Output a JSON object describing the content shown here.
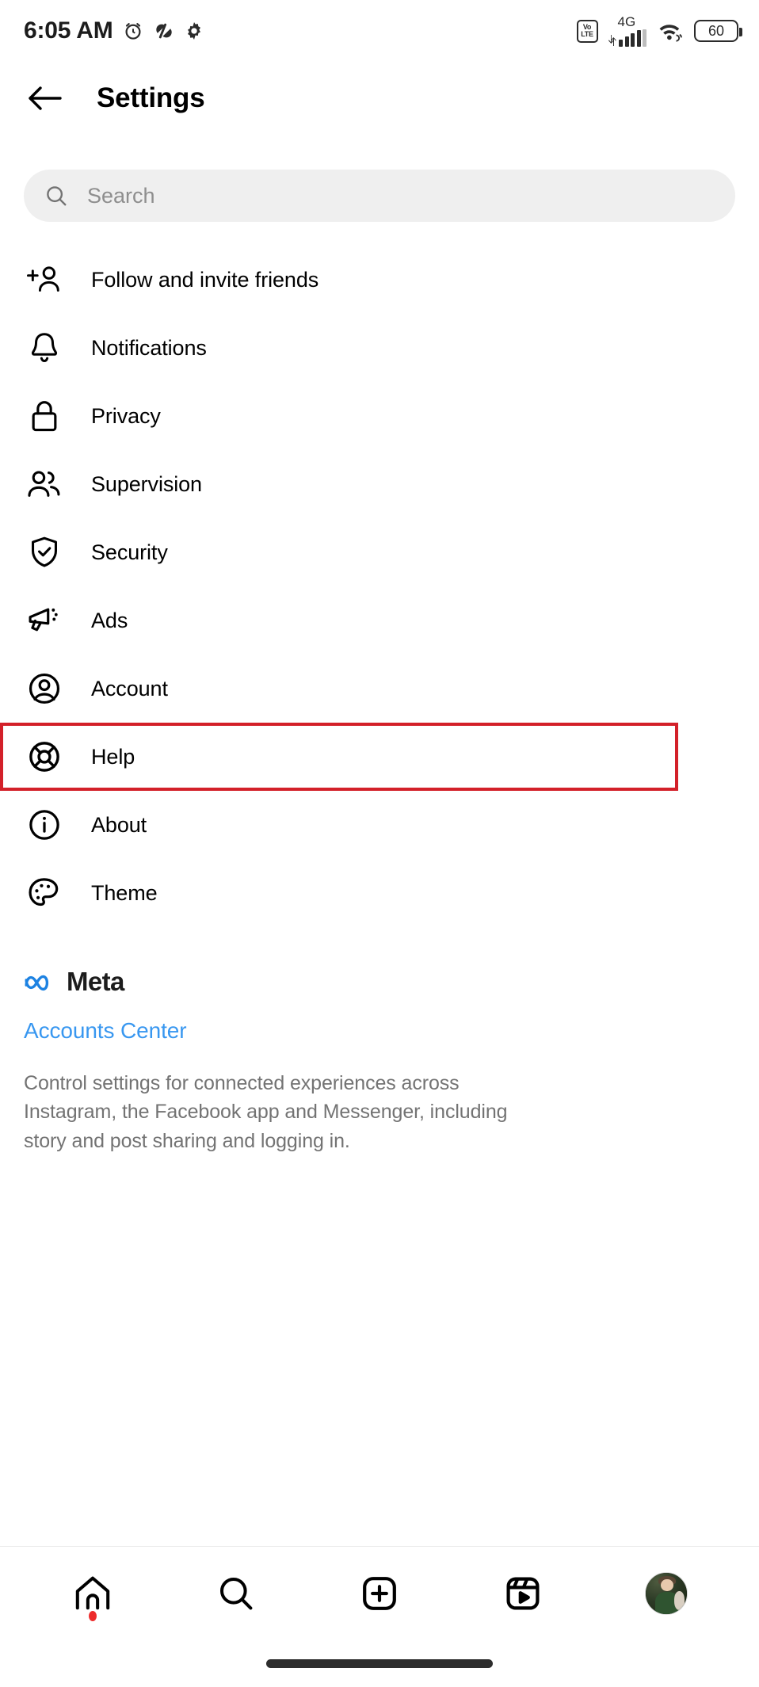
{
  "status_bar": {
    "time": "6:05 AM",
    "left_icons": [
      "alarm-clock-icon",
      "app-activity-icon",
      "gear-icon"
    ],
    "network_type": "4G",
    "volte_top": "Vo",
    "volte_bottom": "LTE",
    "battery_level": "60",
    "right_icons": [
      "volte-icon",
      "cellular-signal-icon",
      "wifi-icon",
      "battery-icon"
    ]
  },
  "app_bar": {
    "back_icon": "back-arrow-icon",
    "title": "Settings"
  },
  "search": {
    "placeholder": "Search",
    "value": "",
    "icon": "search-icon"
  },
  "settings_list": [
    {
      "label": "Follow and invite friends",
      "icon": "add-person-icon",
      "highlighted": false
    },
    {
      "label": "Notifications",
      "icon": "bell-icon",
      "highlighted": false
    },
    {
      "label": "Privacy",
      "icon": "lock-icon",
      "highlighted": false
    },
    {
      "label": "Supervision",
      "icon": "people-icon",
      "highlighted": false
    },
    {
      "label": "Security",
      "icon": "shield-check-icon",
      "highlighted": false
    },
    {
      "label": "Ads",
      "icon": "megaphone-icon",
      "highlighted": false
    },
    {
      "label": "Account",
      "icon": "account-circle-icon",
      "highlighted": false
    },
    {
      "label": "Help",
      "icon": "life-ring-icon",
      "highlighted": true
    },
    {
      "label": "About",
      "icon": "info-circle-icon",
      "highlighted": false
    },
    {
      "label": "Theme",
      "icon": "palette-icon",
      "highlighted": false
    }
  ],
  "meta_section": {
    "brand_icon": "meta-infinity-icon",
    "brand_name": "Meta",
    "accounts_center_link": "Accounts Center",
    "description": "Control settings for connected experiences across Instagram, the Facebook app and Messenger, including story and post sharing and logging in."
  },
  "bottom_nav": [
    {
      "icon": "home-icon",
      "active": true,
      "badge": true
    },
    {
      "icon": "search-icon",
      "active": false,
      "badge": false
    },
    {
      "icon": "create-plus-icon",
      "active": false,
      "badge": false
    },
    {
      "icon": "reels-icon",
      "active": false,
      "badge": false
    },
    {
      "icon": "profile-avatar-icon",
      "active": false,
      "badge": false
    }
  ],
  "colors": {
    "highlight_border": "#d32029",
    "link_blue": "#3897f0",
    "meta_blue": "#1d82e2",
    "search_bg": "#efefef",
    "muted_text": "#737373",
    "badge_red": "#ed2b2b"
  }
}
